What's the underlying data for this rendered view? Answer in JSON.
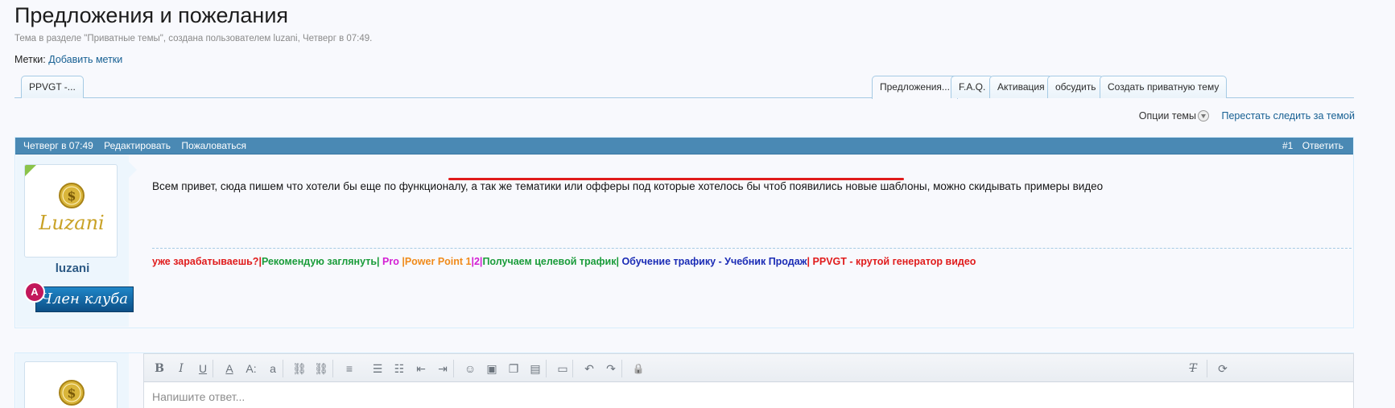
{
  "thread": {
    "title": "Предложения и пожелания",
    "subtitle": "Тема в разделе \"Приватные темы\", создана пользователем luzani, Четверг в 07:49.",
    "tags_label": "Метки:",
    "tags_link": "Добавить метки"
  },
  "tabs_left": [
    {
      "label": "PPVGT -..."
    }
  ],
  "tabs_right": [
    {
      "label": "Предложения...",
      "active": true
    },
    {
      "label": "F.A.Q."
    },
    {
      "label": "Активация"
    },
    {
      "label": "обсудить"
    },
    {
      "label": "Создать приватную тему"
    }
  ],
  "options": {
    "thread_options": "Опции темы",
    "unwatch": "Перестать следить за темой"
  },
  "post": {
    "time": "Четверг в 07:49",
    "edit": "Редактировать",
    "report": "Пожаловаться",
    "number": "#1",
    "reply": "Ответить",
    "username": "luzani",
    "avatar_text": "Luzani",
    "badge_letter": "A",
    "badge_text": "Член клуба",
    "message": "Всем привет, сюда пишем что хотели бы еще по функционалу, а так же тематики или офферы под которые хотелось бы чтоб появились новые шаблоны, можно скидывать примеры видео",
    "signature": [
      {
        "text": "уже зарабатываешь?",
        "color": "#e01b1b"
      },
      {
        "text": "|",
        "color": "#e01b1b"
      },
      {
        "text": "Рекомендую заглянуть",
        "color": "#1a9c3a"
      },
      {
        "text": "| ",
        "color": "#1a9c3a"
      },
      {
        "text": "Pro ",
        "color": "#d31ed3"
      },
      {
        "text": "|",
        "color": "#f08a1a"
      },
      {
        "text": "Power Point 1",
        "color": "#f08a1a"
      },
      {
        "text": "|2|",
        "color": "#d31ed3"
      },
      {
        "text": "Получаем целевой трафик",
        "color": "#1a9c3a"
      },
      {
        "text": "| ",
        "color": "#1a9c3a"
      },
      {
        "text": "Обучение трафику - Учебник Продаж",
        "color": "#1a2bb5"
      },
      {
        "text": "| ",
        "color": "#e01b1b"
      },
      {
        "text": "PPVGT - крутой генератор видео",
        "color": "#e01b1b"
      }
    ]
  },
  "editor": {
    "placeholder": "Напишите ответ...",
    "tools": [
      {
        "name": "bold",
        "glyph": "B"
      },
      {
        "name": "italic",
        "glyph": "I"
      },
      {
        "name": "underline",
        "glyph": "U"
      },
      {
        "name": "font-color",
        "glyph": "A"
      },
      {
        "name": "font-size",
        "glyph": "A:"
      },
      {
        "name": "font-family",
        "glyph": "a"
      },
      {
        "name": "link",
        "glyph": "⛓"
      },
      {
        "name": "unlink",
        "glyph": "⛓"
      },
      {
        "name": "align",
        "glyph": "≡"
      },
      {
        "name": "bullet-list",
        "glyph": "☰"
      },
      {
        "name": "number-list",
        "glyph": "☷"
      },
      {
        "name": "outdent",
        "glyph": "⇤"
      },
      {
        "name": "indent",
        "glyph": "⇥"
      },
      {
        "name": "smiley",
        "glyph": "☺"
      },
      {
        "name": "image",
        "glyph": "▣"
      },
      {
        "name": "media",
        "glyph": "❐"
      },
      {
        "name": "code",
        "glyph": "▤"
      },
      {
        "name": "save-draft",
        "glyph": "▭"
      },
      {
        "name": "undo",
        "glyph": "↶"
      },
      {
        "name": "redo",
        "glyph": "↷"
      },
      {
        "name": "lock",
        "glyph": "🔒"
      },
      {
        "name": "remove-format",
        "glyph": "T"
      },
      {
        "name": "toggle-bbcode",
        "glyph": "⟳"
      }
    ]
  }
}
